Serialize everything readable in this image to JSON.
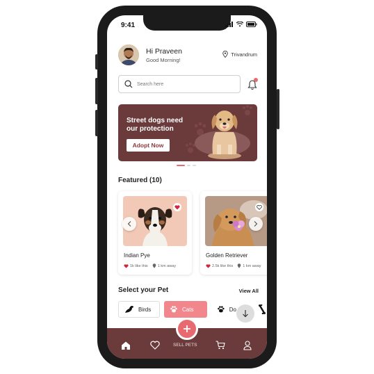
{
  "status": {
    "time": "9:41"
  },
  "header": {
    "greeting": "Hi Praveen",
    "subtitle": "Good Morning!",
    "location": "Trivandrum"
  },
  "search": {
    "placeholder": "Search here"
  },
  "banner": {
    "title_line1": "Street dogs need",
    "title_line2": "our protection",
    "button": "Adopt Now"
  },
  "featured": {
    "title": "Featured (10)",
    "cards": [
      {
        "name": "Indian Pye",
        "likes": "1k like this",
        "distance": "1 km away"
      },
      {
        "name": "Golden Retriever",
        "likes": "2.5k like this",
        "distance": "1 km away"
      }
    ]
  },
  "select_pet": {
    "title": "Select your Pet",
    "view_all": "View All",
    "chips": [
      {
        "label": "Birds"
      },
      {
        "label": "Cats"
      },
      {
        "label": "Do"
      }
    ]
  },
  "nav": {
    "sell_label": "SELL PETS"
  },
  "colors": {
    "brand": "#6b3a3b",
    "accent": "#e66a6f"
  }
}
